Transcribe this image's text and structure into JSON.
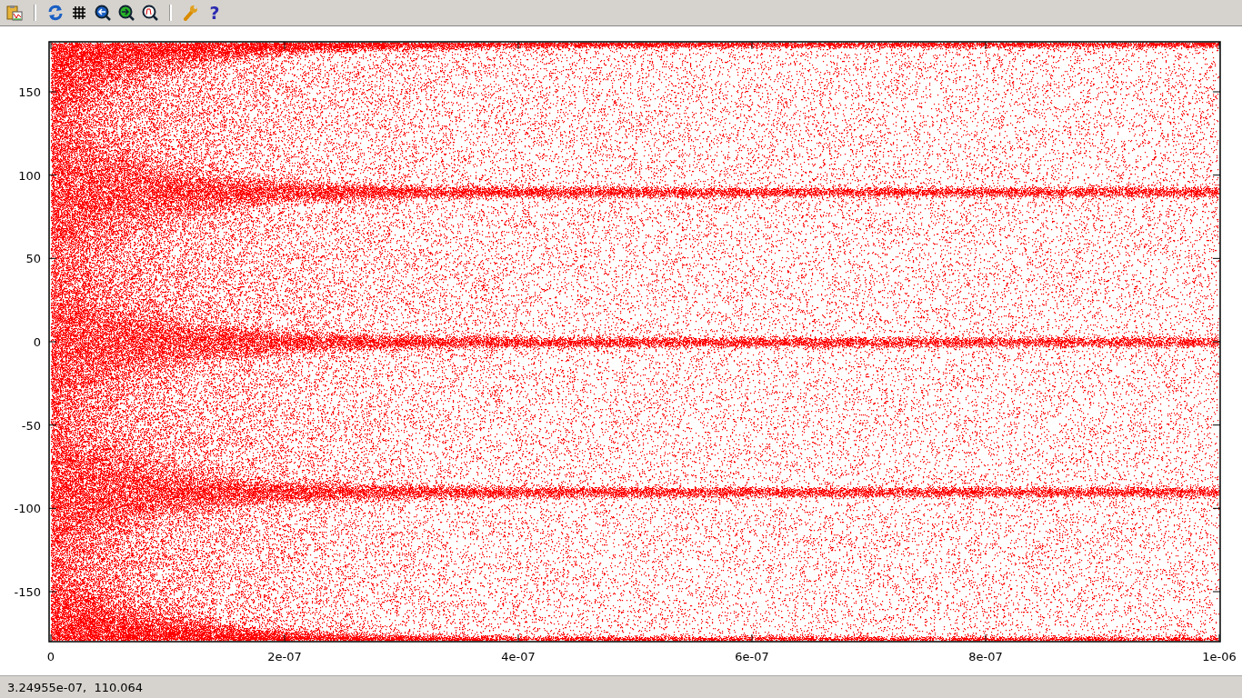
{
  "toolbar": [
    {
      "kind": "copy"
    },
    {
      "kind": "separator"
    },
    {
      "kind": "replot"
    },
    {
      "kind": "grid"
    },
    {
      "kind": "zoom-previous"
    },
    {
      "kind": "zoom-next"
    },
    {
      "kind": "autoscale"
    },
    {
      "kind": "separator"
    },
    {
      "kind": "options"
    },
    {
      "kind": "help",
      "label": "?"
    }
  ],
  "plot": {
    "chart_data": {
      "type": "scatter",
      "xlim": [
        0,
        1e-06
      ],
      "ylim": [
        -180,
        180
      ],
      "xticks": [
        {
          "value": 0,
          "label": "0"
        },
        {
          "value": 2e-07,
          "label": "2e-07"
        },
        {
          "value": 4e-07,
          "label": "4e-07"
        },
        {
          "value": 6e-07,
          "label": "6e-07"
        },
        {
          "value": 8e-07,
          "label": "8e-07"
        },
        {
          "value": 1e-06,
          "label": "1e-06"
        }
      ],
      "yticks": [
        -150,
        -100,
        -50,
        0,
        50,
        100,
        150
      ]
    }
  },
  "status_bar": {
    "text": "3.24955e-07,  110.064"
  }
}
